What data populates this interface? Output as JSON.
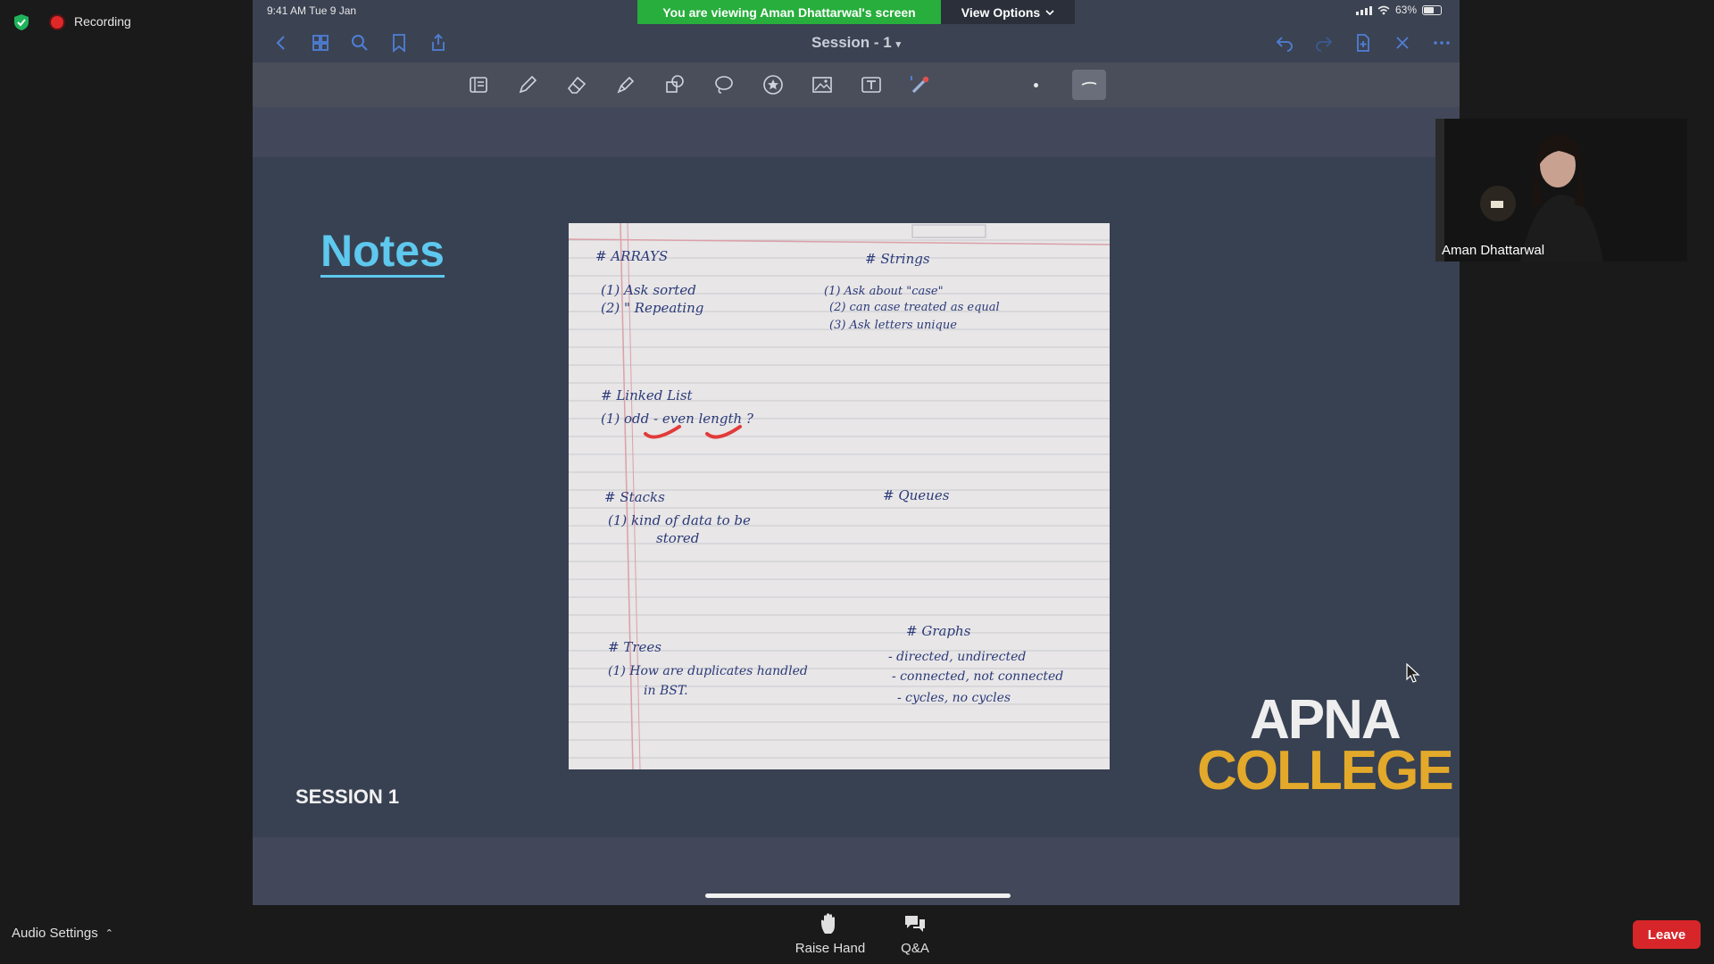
{
  "meeting": {
    "recording_label": "Recording",
    "audio_settings_label": "Audio Settings",
    "raise_hand_label": "Raise Hand",
    "qa_label": "Q&A",
    "leave_label": "Leave",
    "banner_text": "You are viewing Aman Dhattarwal's screen",
    "view_options_label": "View Options",
    "participant_name": "Aman Dhattarwal",
    "colors": {
      "banner": "#27ae3c",
      "leave": "#d7262a",
      "recording": "#e02828"
    }
  },
  "ipad": {
    "status_time": "9:41 AM   Tue 9 Jan",
    "battery": "63%",
    "battery_level": 0.63,
    "document_title": "Session - 1",
    "nav_icons": [
      "back-icon",
      "grid-icon",
      "search-icon",
      "bookmark-icon",
      "share-icon",
      "undo-icon",
      "redo-icon",
      "add-page-icon",
      "close-icon",
      "more-icon"
    ],
    "tools": [
      "page-tool-icon",
      "pen-icon",
      "eraser-icon",
      "highlighter-icon",
      "shapes-icon",
      "lasso-icon",
      "sticker-icon",
      "image-icon",
      "text-icon",
      "laser-pointer-icon",
      "dot-size-icon",
      "stroke-icon"
    ]
  },
  "slide": {
    "title": "Notes",
    "session_label": "SESSION 1",
    "brand_line1": "APNA",
    "brand_line2": "COLLEGE",
    "colors": {
      "title": "#5ec8ee",
      "brand_accent": "#e3a92a",
      "background": "#384152"
    },
    "notes": {
      "arrays": {
        "heading": "# ARRAYS",
        "items": [
          "(1)  Ask  sorted",
          "(2)  \"   Repeating"
        ]
      },
      "strings": {
        "heading": "# Strings",
        "items": [
          "(1)  Ask  about \"case\"",
          "(2)  can case treated as equal",
          "(3)  Ask letters unique"
        ]
      },
      "linked_list": {
        "heading": "# Linked List",
        "items": [
          "(1)  odd - even length ?"
        ]
      },
      "stacks": {
        "heading": "# Stacks",
        "items": [
          "(1)  kind of data to be",
          "stored"
        ]
      },
      "queues": {
        "heading": "# Queues"
      },
      "trees": {
        "heading": "# Trees",
        "items": [
          "(1)  How are duplicates handled",
          "in  BST."
        ]
      },
      "graphs": {
        "heading": "# Graphs",
        "items": [
          "- directed, undirected",
          "- connected, not connected",
          "- cycles, no cycles"
        ]
      }
    }
  }
}
